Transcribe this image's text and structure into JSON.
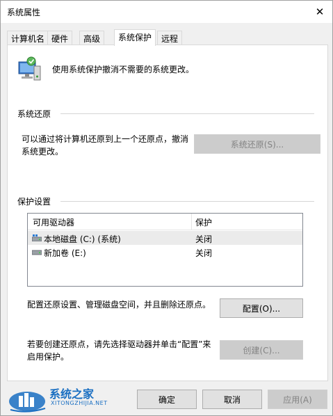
{
  "window": {
    "title": "系统属性",
    "close_glyph": "✕"
  },
  "tabs": [
    {
      "label": "计算机名",
      "active": false
    },
    {
      "label": "硬件",
      "active": false
    },
    {
      "label": "高级",
      "active": false
    },
    {
      "label": "系统保护",
      "active": true
    },
    {
      "label": "远程",
      "active": false
    }
  ],
  "header": {
    "description": "使用系统保护撤消不需要的系统更改。",
    "icon": "system-protection-icon"
  },
  "system_restore": {
    "group_label": "系统还原",
    "description_line1": "可以通过将计算机还原到上一个还原点，撤消",
    "description_line2": "系统更改。",
    "button_label": "系统还原(S)..."
  },
  "protection_settings": {
    "group_label": "保护设置",
    "columns": [
      "可用驱动器",
      "保护"
    ],
    "drives": [
      {
        "name": "本地磁盘 (C:) (系统)",
        "protection": "关闭",
        "icon": "system-drive-icon",
        "selected": true
      },
      {
        "name": "新加卷 (E:)",
        "protection": "关闭",
        "icon": "drive-icon",
        "selected": false
      }
    ],
    "configure_text": "配置还原设置、管理磁盘空间，并且删除还原点。",
    "configure_button": "配置(O)...",
    "create_text_line1": "若要创建还原点，请先选择驱动器并单击“配置”来",
    "create_text_line2": "启用保护。",
    "create_button": "创建(C)..."
  },
  "footer": {
    "ok": "确定",
    "cancel": "取消",
    "apply": "应用(A)"
  },
  "watermark": {
    "title": "系统之家",
    "subtitle": "XITONGZHIJIA.NET"
  },
  "colors": {
    "window_bg": "#f0f0f0",
    "panel_bg": "#ffffff",
    "selected_row": "#ebebeb",
    "disabled_text": "#838383",
    "watermark_blue": "#1a6fc2"
  }
}
